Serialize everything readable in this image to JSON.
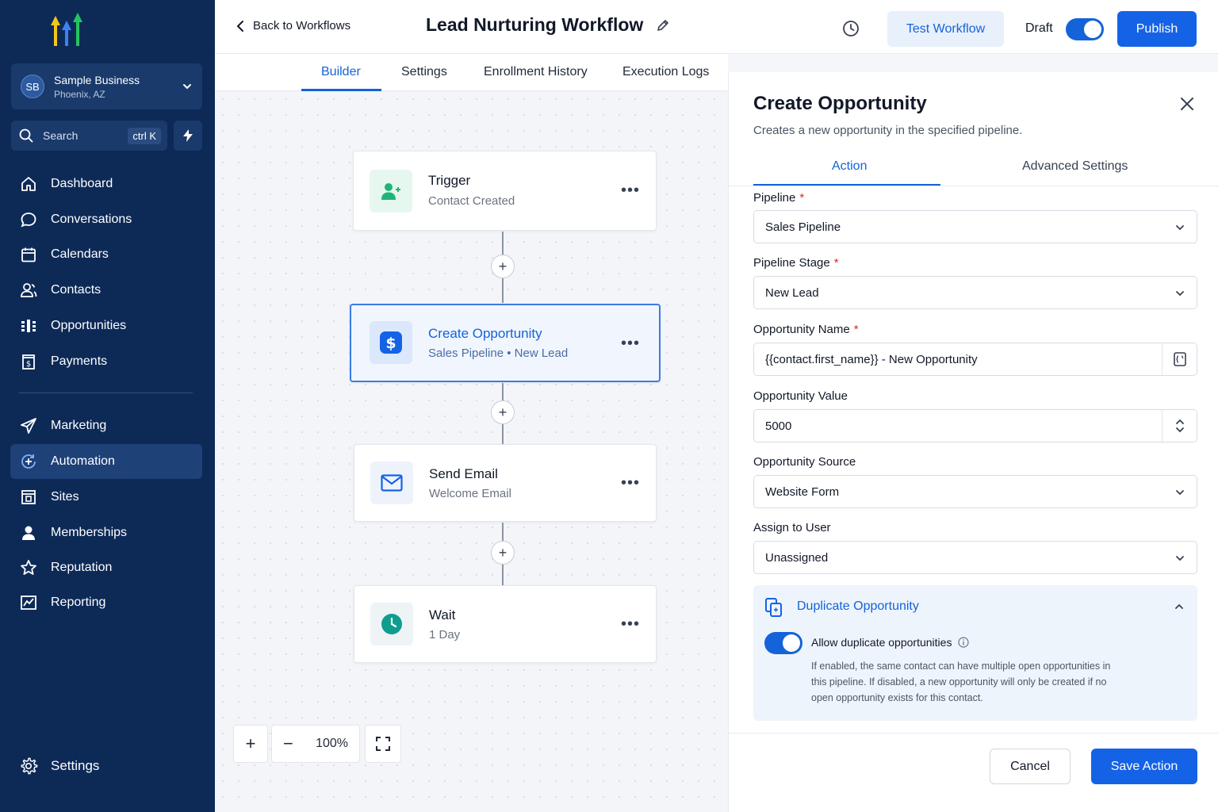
{
  "sidebar": {
    "account": {
      "initials": "SB",
      "name": "Sample Business",
      "location": "Phoenix, AZ"
    },
    "search": {
      "label": "Search",
      "shortcut": "ctrl K"
    },
    "items": [
      {
        "label": "Dashboard",
        "icon": "home-icon"
      },
      {
        "label": "Conversations",
        "icon": "chat-icon"
      },
      {
        "label": "Calendars",
        "icon": "calendar-icon"
      },
      {
        "label": "Contacts",
        "icon": "contacts-icon"
      },
      {
        "label": "Opportunities",
        "icon": "opportunities-icon"
      },
      {
        "label": "Payments",
        "icon": "payments-icon"
      },
      {
        "label": "Marketing",
        "icon": "send-icon"
      },
      {
        "label": "Automation",
        "icon": "automation-icon",
        "active": true
      },
      {
        "label": "Sites",
        "icon": "sites-icon"
      },
      {
        "label": "Memberships",
        "icon": "user-icon"
      },
      {
        "label": "Reputation",
        "icon": "star-icon"
      },
      {
        "label": "Reporting",
        "icon": "chart-icon"
      }
    ],
    "settings_label": "Settings"
  },
  "header": {
    "back_label": "Back to Workflows",
    "title": "Lead Nurturing Workflow",
    "test_label": "Test Workflow",
    "draft_label": "Draft",
    "draft_on": true,
    "publish_label": "Publish"
  },
  "tabs": [
    {
      "label": "Builder",
      "active": true
    },
    {
      "label": "Settings"
    },
    {
      "label": "Enrollment History"
    },
    {
      "label": "Execution Logs"
    }
  ],
  "canvas": {
    "nodes": [
      {
        "title": "Trigger",
        "subtitle": "Contact Created",
        "icon": "user-plus-icon"
      },
      {
        "title": "Create Opportunity",
        "subtitle": "Sales Pipeline • New Lead",
        "icon": "dollar-icon",
        "selected": true
      },
      {
        "title": "Send Email",
        "subtitle": "Welcome Email",
        "icon": "mail-icon"
      },
      {
        "title": "Wait",
        "subtitle": "1 Day",
        "icon": "clock-icon"
      }
    ],
    "more_label": "•••",
    "add_label": "+",
    "zoom": {
      "plus": "+",
      "minus": "−",
      "level": "100%"
    }
  },
  "panel": {
    "title": "Create Opportunity",
    "description": "Creates a new opportunity in the specified pipeline.",
    "tabs": [
      {
        "label": "Action",
        "active": true
      },
      {
        "label": "Advanced Settings"
      }
    ],
    "fields": {
      "pipeline": {
        "label": "Pipeline",
        "required": "*",
        "value": "Sales Pipeline"
      },
      "stage": {
        "label": "Pipeline Stage",
        "required": "*",
        "value": "New Lead"
      },
      "name": {
        "label": "Opportunity Name",
        "required": "*",
        "value": "{{contact.first_name}} - New Opportunity"
      },
      "value": {
        "label": "Opportunity Value",
        "value": "5000"
      },
      "source": {
        "label": "Opportunity Source",
        "value": "Website Form"
      },
      "assign": {
        "label": "Assign to User",
        "value": "Unassigned"
      }
    },
    "duplicate": {
      "title": "Duplicate Opportunity",
      "toggle_label": "Allow duplicate opportunities",
      "enabled": true,
      "help": "If enabled, the same contact can have multiple open opportunities in this pipeline. If disabled, a new opportunity will only be created if no open opportunity exists for this contact."
    },
    "cancel_label": "Cancel",
    "save_label": "Save Action"
  },
  "colors": {
    "brand": "#1463e6",
    "sidebar": "#0d2a57",
    "trigger_icon": "#1fb57a",
    "wait_icon": "#0f9d8f"
  }
}
